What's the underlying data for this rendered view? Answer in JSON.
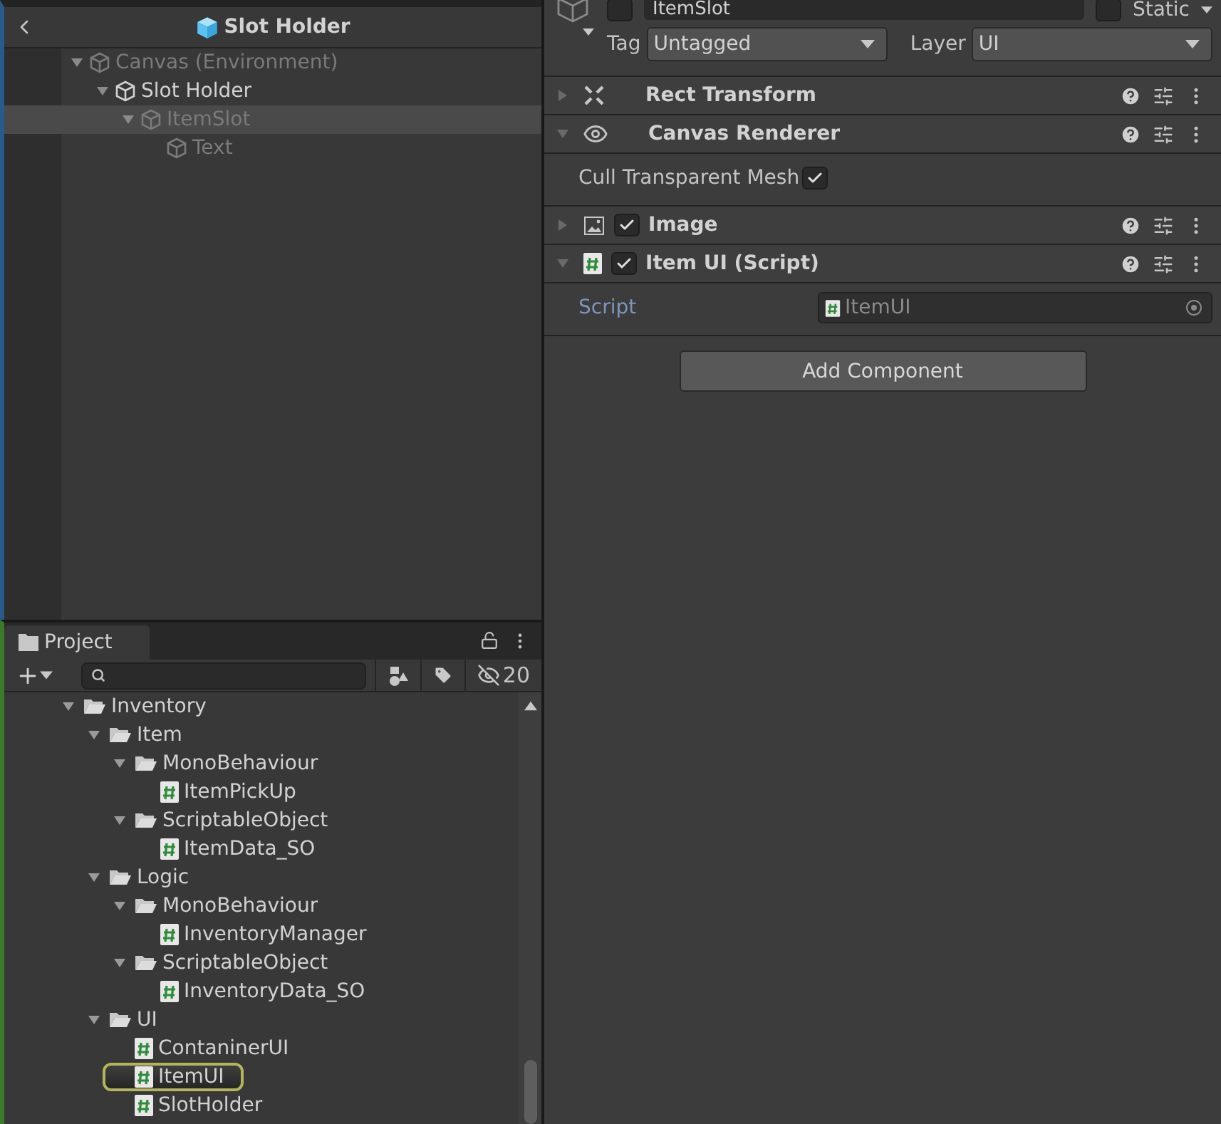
{
  "hierarchy": {
    "title": "Slot Holder",
    "tree": [
      {
        "label": "Canvas (Environment)",
        "dimmed": true,
        "selected": false,
        "expanded": true,
        "children": [
          {
            "label": "Slot Holder",
            "dimmed": false,
            "selected": false,
            "expanded": true,
            "children": [
              {
                "label": "ItemSlot",
                "dimmed": true,
                "selected": true,
                "expanded": true,
                "children": [
                  {
                    "label": "Text",
                    "dimmed": true,
                    "selected": false
                  }
                ]
              }
            ]
          }
        ]
      }
    ]
  },
  "project": {
    "tab": "Project",
    "hidden_count": "20",
    "tree": [
      {
        "label": "Inventory",
        "kind": "folder",
        "selected": false,
        "expanded": true,
        "children": [
          {
            "label": "Item",
            "kind": "folder",
            "selected": false,
            "expanded": true,
            "children": [
              {
                "label": "MonoBehaviour",
                "kind": "folder",
                "selected": false,
                "expanded": true,
                "children": [
                  {
                    "label": "ItemPickUp",
                    "kind": "script",
                    "selected": false
                  }
                ]
              },
              {
                "label": "ScriptableObject",
                "kind": "folder",
                "selected": false,
                "expanded": true,
                "children": [
                  {
                    "label": "ItemData_SO",
                    "kind": "script",
                    "selected": false
                  }
                ]
              }
            ]
          },
          {
            "label": "Logic",
            "kind": "folder",
            "selected": false,
            "expanded": true,
            "children": [
              {
                "label": "MonoBehaviour",
                "kind": "folder",
                "selected": false,
                "expanded": true,
                "children": [
                  {
                    "label": "InventoryManager",
                    "kind": "script",
                    "selected": false
                  }
                ]
              },
              {
                "label": "ScriptableObject",
                "kind": "folder",
                "selected": false,
                "expanded": true,
                "children": [
                  {
                    "label": "InventoryData_SO",
                    "kind": "script",
                    "selected": false
                  }
                ]
              }
            ]
          },
          {
            "label": "UI",
            "kind": "folder",
            "selected": false,
            "expanded": true,
            "children": [
              {
                "label": "ContaninerUI",
                "kind": "script",
                "selected": false
              },
              {
                "label": "ItemUI",
                "kind": "script",
                "selected": true
              },
              {
                "label": "SlotHolder",
                "kind": "script",
                "selected": false
              }
            ]
          }
        ]
      }
    ]
  },
  "inspector": {
    "object_name": "ItemSlot",
    "active": false,
    "static": false,
    "static_label": "Static",
    "tag_label": "Tag",
    "tag": "Untagged",
    "layer_label": "Layer",
    "layer": "UI",
    "components": [
      {
        "name": "Rect Transform",
        "kind": "transform",
        "expanded": false
      },
      {
        "name": "Canvas Renderer",
        "kind": "renderer",
        "expanded": true,
        "properties": [
          {
            "label": "Cull Transparent Mesh",
            "kind": "toggle",
            "checked": true
          }
        ]
      },
      {
        "name": "Image",
        "kind": "image",
        "expanded": false,
        "enabled": true
      },
      {
        "name": "Item UI (Script)",
        "kind": "script",
        "expanded": true,
        "enabled": true,
        "properties": [
          {
            "label": "Script",
            "kind": "object",
            "value": "ItemUI"
          }
        ]
      }
    ],
    "add_button": "Add Component"
  }
}
